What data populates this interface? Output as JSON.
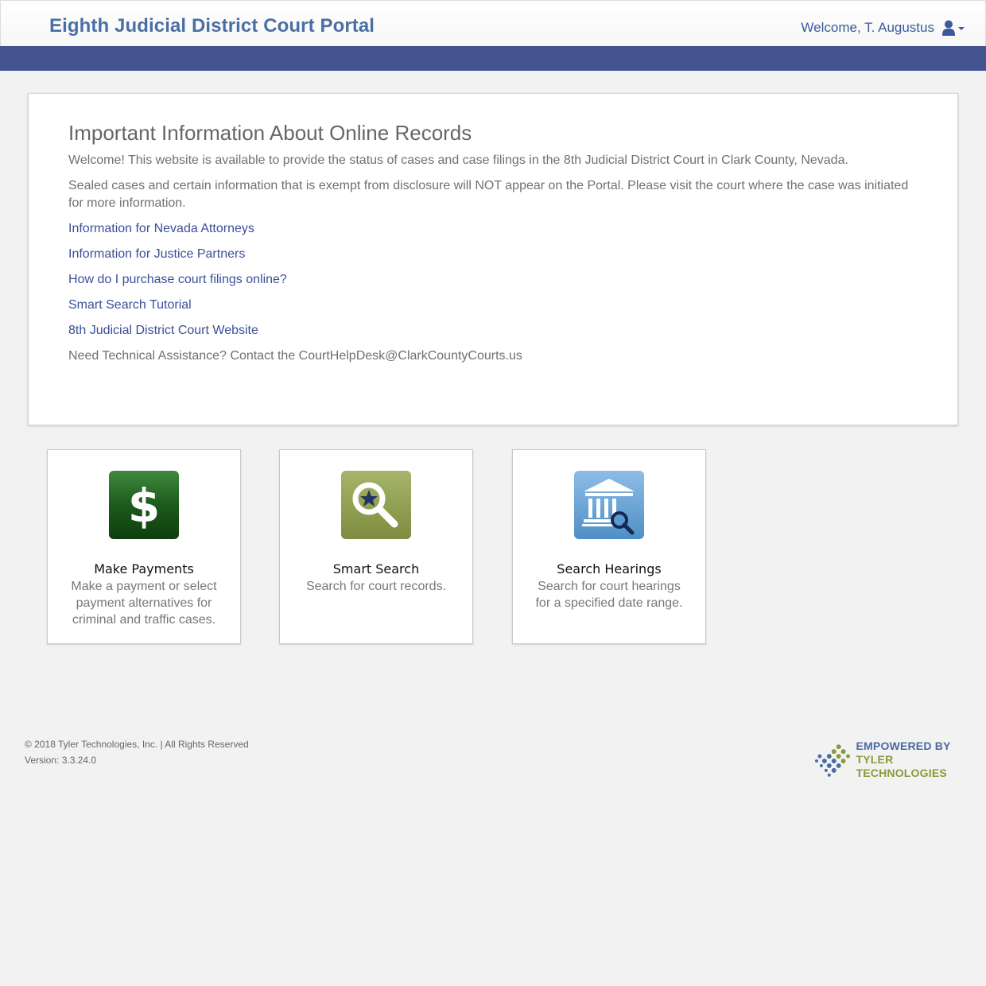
{
  "header": {
    "title": "Eighth Judicial District Court Portal",
    "welcome": "Welcome, T. Augustus"
  },
  "info": {
    "title": "Important Information About Online Records",
    "intro": "Welcome! This website is available to provide the status of cases and case filings in the 8th Judicial District Court in Clark County, Nevada.",
    "sealed": "Sealed cases and certain information that is exempt from disclosure will NOT appear on the Portal. Please visit the court where the case was initiated for more information.",
    "links": [
      "Information for Nevada Attorneys",
      "Information for Justice Partners",
      "How do I purchase court filings online?",
      "Smart Search Tutorial",
      "8th Judicial District Court Website"
    ],
    "help": "Need Technical Assistance? Contact the CourtHelpDesk@ClarkCountyCourts.us"
  },
  "tiles": [
    {
      "title": "Make Payments",
      "desc": "Make a payment or select payment alternatives for criminal and traffic cases.",
      "icon": "dollar-icon",
      "color": "#1b5a1b"
    },
    {
      "title": "Smart Search",
      "desc": "Search for court records.",
      "icon": "magnifier-star-icon",
      "color": "#8a9a4a"
    },
    {
      "title": "Search Hearings",
      "desc": "Search for court hearings for a specified date range.",
      "icon": "courthouse-search-icon",
      "color": "#5b9bd0"
    }
  ],
  "footer": {
    "copyright": "© 2018 Tyler Technologies, Inc. | All Rights Reserved",
    "version": "Version: 3.3.24.0",
    "logo_line1": "EMPOWERED BY",
    "logo_line2": "TYLER TECHNOLOGIES"
  },
  "colors": {
    "nav_bar": "#43538f",
    "title": "#4a6fa5",
    "link": "#3b4f99"
  }
}
